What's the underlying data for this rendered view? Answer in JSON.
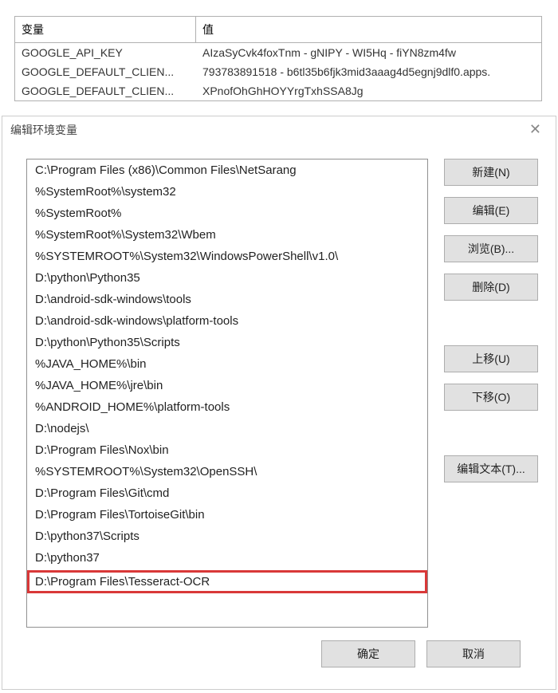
{
  "bg_table": {
    "header": {
      "variable": "变量",
      "value": "值"
    },
    "rows": [
      {
        "variable": "GOOGLE_API_KEY",
        "value": "AIzaSyCvk4foxTnm - gNIPY - WI5Hq - fiYN8zm4fw"
      },
      {
        "variable": "GOOGLE_DEFAULT_CLIEN...",
        "value": "793783891518 - b6tl35b6fjk3mid3aaag4d5egnj9dlf0.apps."
      },
      {
        "variable": "GOOGLE_DEFAULT_CLIEN...",
        "value": "XPnofOhGhHOYYrgTxhSSA8Jg"
      }
    ]
  },
  "dialog": {
    "title": "编辑环境变量",
    "list_items": [
      "C:\\Program Files (x86)\\Common Files\\NetSarang",
      "%SystemRoot%\\system32",
      "%SystemRoot%",
      "%SystemRoot%\\System32\\Wbem",
      "%SYSTEMROOT%\\System32\\WindowsPowerShell\\v1.0\\",
      "D:\\python\\Python35",
      "D:\\android-sdk-windows\\tools",
      "D:\\android-sdk-windows\\platform-tools",
      "D:\\python\\Python35\\Scripts",
      "%JAVA_HOME%\\bin",
      "%JAVA_HOME%\\jre\\bin",
      "%ANDROID_HOME%\\platform-tools",
      "D:\\nodejs\\",
      "D:\\Program Files\\Nox\\bin",
      "%SYSTEMROOT%\\System32\\OpenSSH\\",
      "D:\\Program Files\\Git\\cmd",
      "D:\\Program Files\\TortoiseGit\\bin",
      "D:\\python37\\Scripts",
      "D:\\python37",
      "D:\\Program Files\\Tesseract-OCR"
    ],
    "highlighted_index": 19,
    "buttons": {
      "new": "新建(N)",
      "edit": "编辑(E)",
      "browse": "浏览(B)...",
      "delete": "删除(D)",
      "move_up": "上移(U)",
      "move_down": "下移(O)",
      "edit_text": "编辑文本(T)..."
    },
    "footer": {
      "ok": "确定",
      "cancel": "取消"
    }
  }
}
